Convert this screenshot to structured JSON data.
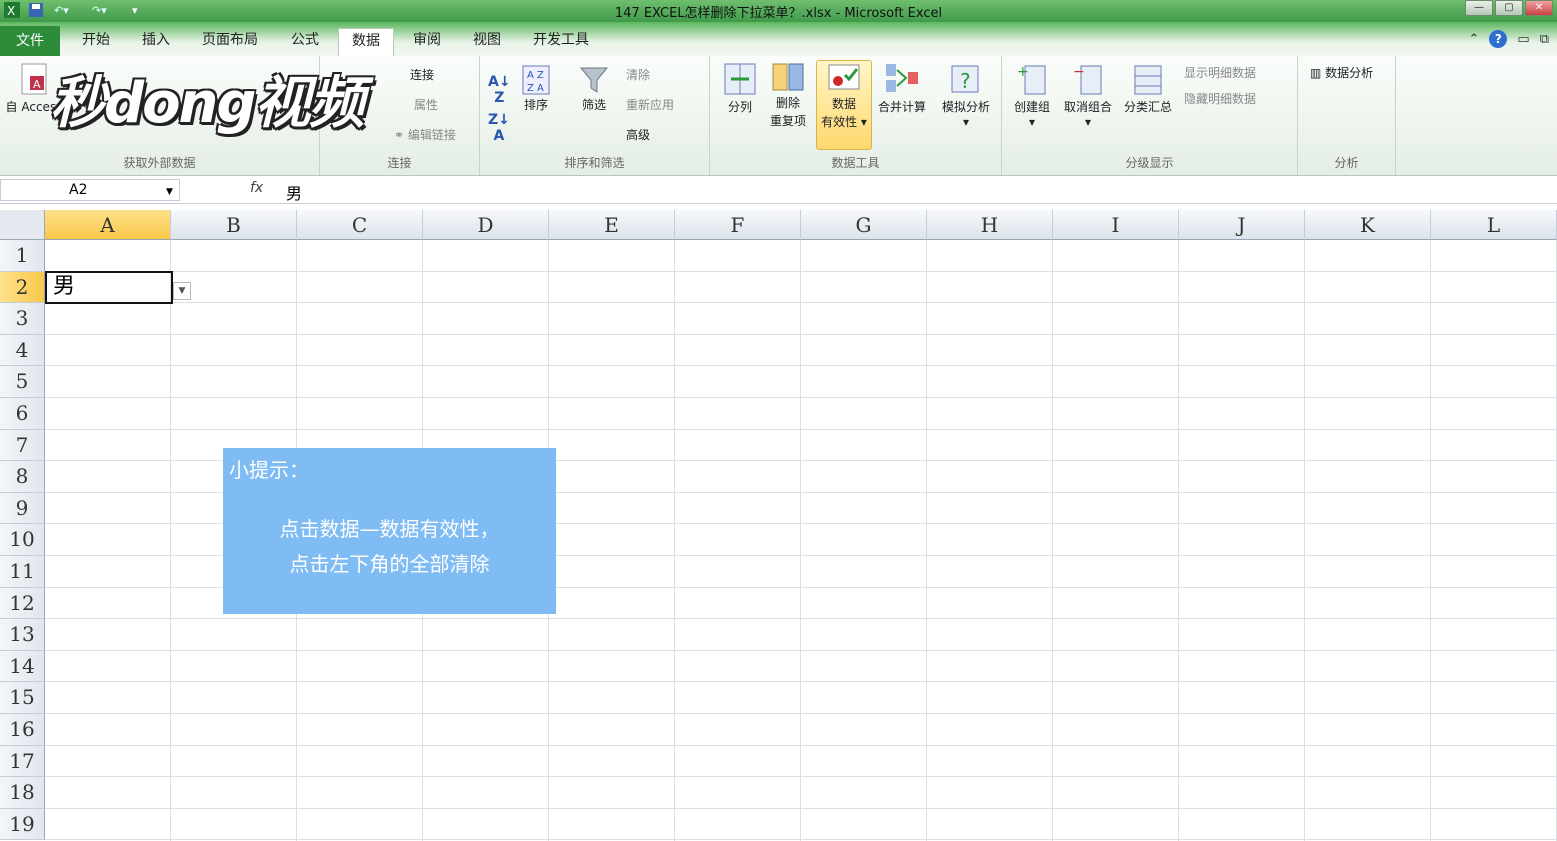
{
  "window": {
    "title": "147 EXCEL怎样删除下拉菜单？.xlsx - Microsoft Excel",
    "controls": [
      "—",
      "▢",
      "✕"
    ]
  },
  "tabs": [
    {
      "label": "文件"
    },
    {
      "label": "开始"
    },
    {
      "label": "插入"
    },
    {
      "label": "页面布局"
    },
    {
      "label": "公式"
    },
    {
      "label": "数据"
    },
    {
      "label": "审阅"
    },
    {
      "label": "视图"
    },
    {
      "label": "开发工具"
    }
  ],
  "ribbon": {
    "external": {
      "access": "自 Access",
      "group": "获取外部数据"
    },
    "connections": {
      "connect": "连接",
      "props": "属性",
      "edit_links": "编辑链接",
      "group": "连接"
    },
    "sort": {
      "sort": "排序",
      "filter": "筛选",
      "clear": "清除",
      "reapply": "重新应用",
      "advanced": "高级",
      "group": "排序和筛选"
    },
    "tools": {
      "split": "分列",
      "remove_dup_1": "删除",
      "remove_dup_2": "重复项",
      "validation_1": "数据",
      "validation_2": "有效性",
      "consolidate": "合并计算",
      "whatif": "模拟分析",
      "group": "数据工具"
    },
    "outline": {
      "group_btn": "创建组",
      "ungroup": "取消组合",
      "subtotal": "分类汇总",
      "show_detail": "显示明细数据",
      "hide_detail": "隐藏明细数据",
      "group": "分级显示"
    },
    "analysis": {
      "data_analysis": "数据分析",
      "group": "分析"
    }
  },
  "watermark": "秒dong视频",
  "formula_bar": {
    "name_box": "A2",
    "fx": "fx",
    "content": "男"
  },
  "columns": [
    "A",
    "B",
    "C",
    "D",
    "E",
    "F",
    "G",
    "H",
    "I",
    "J",
    "K",
    "L"
  ],
  "rows": [
    "1",
    "2",
    "3",
    "4",
    "5",
    "6",
    "7",
    "8",
    "9",
    "10",
    "11",
    "12",
    "13",
    "14",
    "15",
    "16",
    "17",
    "18",
    "19"
  ],
  "cell_a2": "男",
  "tip": {
    "title": "小提示：",
    "line1": "点击数据—数据有效性，",
    "line2": "点击左下角的全部清除"
  }
}
